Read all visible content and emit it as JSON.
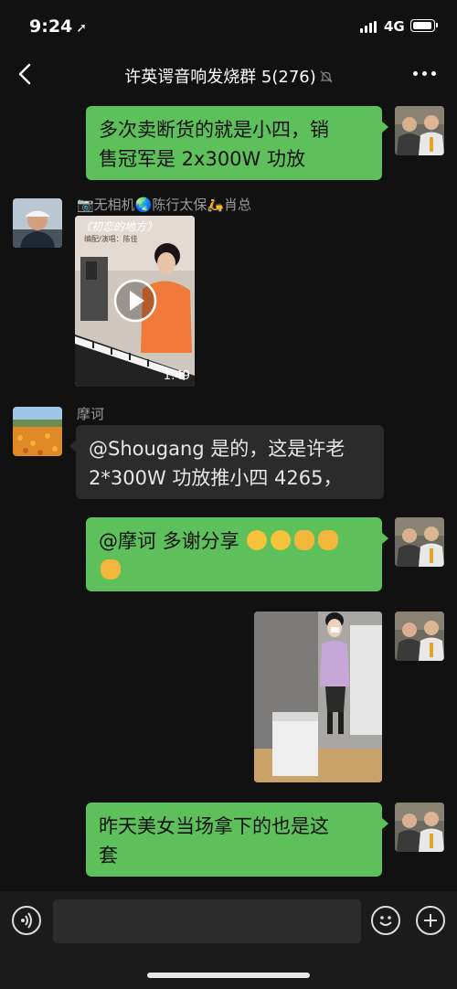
{
  "status_bar": {
    "time": "9:24",
    "location_arrow": "location-arrow-icon",
    "network": "4G"
  },
  "header": {
    "title": "许英谔音响发烧群 5(276)",
    "back_icon": "chevron-left-icon",
    "mute_icon": "bell-muted-icon",
    "more_icon": "more-dots-icon"
  },
  "messages": [
    {
      "id": "m1",
      "side": "right",
      "type": "text",
      "lines": [
        "多次卖断货的就是小四，销",
        "售冠军是 2x300W 功放"
      ]
    },
    {
      "id": "m2",
      "side": "left",
      "type": "video",
      "sender": "📷无相机🌏陈行太保🛵肖总",
      "video_title": "《初恋的地方》",
      "video_subtitle": "编配/演唱：陈佳",
      "duration": "1:49"
    },
    {
      "id": "m3",
      "side": "left",
      "type": "text",
      "sender": "摩诃",
      "lines": [
        "@Shougang 是的，这是许老",
        "2*300W 功放推小四 4265，"
      ]
    },
    {
      "id": "m4",
      "side": "right",
      "type": "text",
      "lines": [
        "@摩诃  多谢分享"
      ],
      "emojis": [
        "grinning-face-emoji",
        "hugging-face-emoji",
        "thumbs-up-emoji",
        "clapping-hands-emoji",
        "handshake-emoji"
      ]
    },
    {
      "id": "m5",
      "side": "right",
      "type": "image"
    },
    {
      "id": "m6",
      "side": "right",
      "type": "text",
      "lines": [
        "昨天美女当场拿下的也是这",
        "套"
      ]
    }
  ],
  "input_bar": {
    "voice_icon": "voice-icon",
    "message_placeholder": "",
    "emoji_icon": "smiley-icon",
    "plus_icon": "plus-circle-icon"
  },
  "colors": {
    "background": "#111111",
    "outgoing_bubble": "#5ec05a",
    "incoming_bubble": "#2b2b2b",
    "sender_name": "#9a9a9a"
  }
}
